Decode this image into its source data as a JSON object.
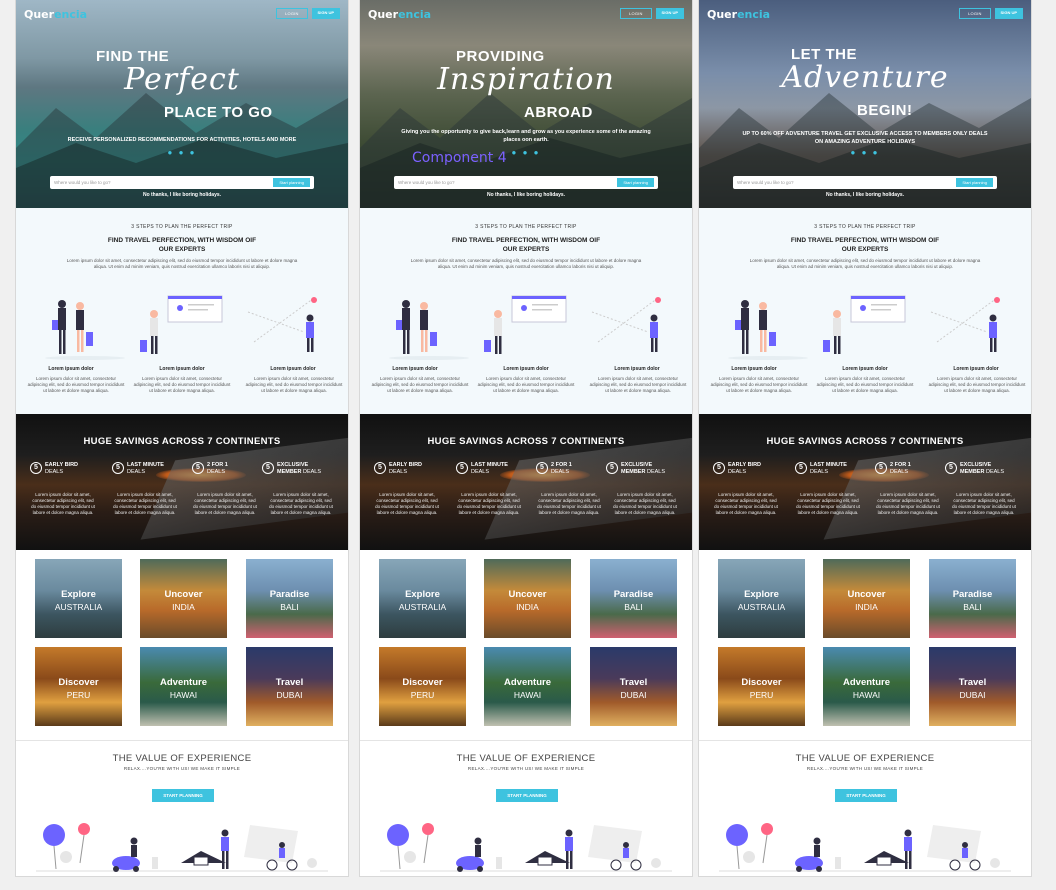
{
  "brand": {
    "part1": "Quer",
    "part2": "encia"
  },
  "nav": {
    "login": "LOGIN",
    "signup": "SIGN UP"
  },
  "pages": [
    {
      "hero": {
        "line1": "FIND THE",
        "script": "Perfect",
        "line2": "PLACE TO GO",
        "sub": "RECEIVE PERSONALIZED RECOMMENDATIONS FOR ACTIVITIES, HOTELS AND MORE"
      }
    },
    {
      "hero": {
        "line1": "PROVIDING",
        "script": "Inspiration",
        "line2": "ABROAD",
        "sub": "Giving you the opportunity to give back,learn and grow as you experience some of the amazing places oon earth.",
        "overlay": "Component 4"
      }
    },
    {
      "hero": {
        "line1": "LET THE",
        "script": "Adventure",
        "line2": "BEGIN!",
        "sub": "UP TO 60% OFF ADVENTURE TRAVEL GET EXCLUSIVE ACCESS TO MEMBERS ONLY DEALS ON AMAZING ADVENTURE HOLIDAYS"
      }
    }
  ],
  "search": {
    "placeholder": "Where would you like to go?",
    "button": "Start planning"
  },
  "no_thanks": "No thanks, I like boring holidays.",
  "steps": {
    "kicker": "3 STEPS TO PLAN  THE PERFECT TRIP",
    "title": "FIND TRAVEL PERFECTION, WITH WISDOM OIF OUR EXPERTS",
    "para": "Lorem ipsum dolor sit amet, consectetur adipiscing elit, sed do eiusmod tempor incididunt ut labore et dolore magna aliqua. Ut enim ad minim veniam, quis nostrud exercitation ullamco laboris nisi ut aliquip.",
    "cols": [
      {
        "heading": "Lorem ipsum dolor",
        "text": "Lorem ipsum dolor sit amet, consectetur adipiscing elit, sed do eiusmod tempor incididunt ut labore et dolore magna aliqua."
      },
      {
        "heading": "Lorem ipsum dolor",
        "text": "Lorem ipsum dolor sit amet, consectetur adipiscing elit, sed do eiusmod tempor incididunt ut labore et dolore magna aliqua."
      },
      {
        "heading": "Lorem ipsum dolor",
        "text": "Lorem ipsum dolor sit amet, consectetur adipiscing elit, sed do eiusmod tempor incididunt ut labore et dolore magna aliqua."
      }
    ]
  },
  "savings": {
    "title": "HUGE SAVINGS ACROSS 7 CONTINENTS",
    "deals": [
      {
        "bold": "EARLY BIRD",
        "rest": "DEALS",
        "icon": "5",
        "text": "Lorem ipsum dolor sit amet, consectetur adipiscing elit, sed do eiusmod tempor incididunt ut labore et dolore magna aliqua."
      },
      {
        "bold": "LAST MINUTE",
        "rest": "DEALS",
        "icon": "5",
        "text": "Lorem ipsum dolor sit amet, consectetur adipiscing elit, sed do eiusmod tempor incididunt ut labore et dolore magna aliqua."
      },
      {
        "bold": "2 FOR 1",
        "rest": "DEALS",
        "icon": "5",
        "text": "Lorem ipsum dolor sit amet, consectetur adipiscing elit, sed do eiusmod tempor incididunt ut labore et dolore magna aliqua."
      },
      {
        "bold": "EXCLUSIVE",
        "rest2": "MEMBER",
        "rest": "DEALS",
        "icon": "5",
        "text": "Lorem ipsum dolor sit amet, consectetur adipiscing elit, sed do eiusmod tempor incididunt ut labore et dolore magna aliqua."
      }
    ]
  },
  "destinations": [
    {
      "title": "Explore",
      "place": "AUSTRALIA"
    },
    {
      "title": "Uncover",
      "place": "INDIA"
    },
    {
      "title": "Paradise",
      "place": "BALI"
    },
    {
      "title": "Discover",
      "place": "PERU"
    },
    {
      "title": "Adventure",
      "place": "HAWAI"
    },
    {
      "title": "Travel",
      "place": "DUBAI"
    }
  ],
  "value": {
    "title": "THE VALUE OF EXPERIENCE",
    "sub": "RELAX....YOU'RE WITH US! WE MAKE IT SIMPLE",
    "button": "START PLANNING"
  },
  "colors": {
    "accent": "#3ec3df",
    "illustration": "#6c63ff"
  }
}
